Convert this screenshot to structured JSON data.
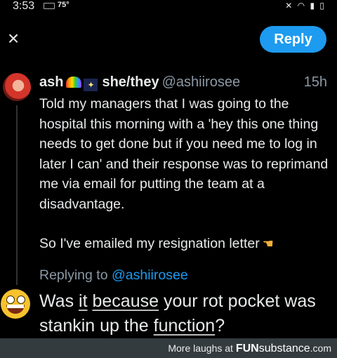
{
  "status_bar": {
    "time": "3:53",
    "temperature": "75°",
    "icons": [
      "mute-icon",
      "wifi-icon",
      "signal-icon",
      "battery-icon"
    ]
  },
  "toolbar": {
    "close_icon": "close-icon",
    "reply_label": "Reply"
  },
  "tweet": {
    "display_name": "ash",
    "emojis": [
      "rainbow",
      "night-sky"
    ],
    "pronouns": "she/they",
    "handle": "@ashiirosee",
    "time": "15h",
    "paragraph1": "Told my managers that I was going to the hospital this morning with a 'hey this one thing needs to get done but if you need me to log in later I can' and their response was to reprimand me via email for putting the team at a disadvantage.",
    "paragraph2": "So I've emailed my resignation letter",
    "paragraph2_emoji": "backhand-pointing-left"
  },
  "reply": {
    "replying_prefix": "Replying to",
    "replying_handle": "@ashiirosee",
    "w1": "Was",
    "w2": "it",
    "w3": "because",
    "w4": "your rot pocket was stankin up the",
    "w5": "function",
    "w6": "?"
  },
  "footer": {
    "prefix": "More laughs at",
    "brand_bold": "FUN",
    "brand_light": "substance",
    "brand_suffix": ".com"
  },
  "colors": {
    "accent": "#1d9bf0",
    "background": "#000000",
    "secondary_text": "#8b98a5",
    "footer_bg": "#343b3f"
  }
}
